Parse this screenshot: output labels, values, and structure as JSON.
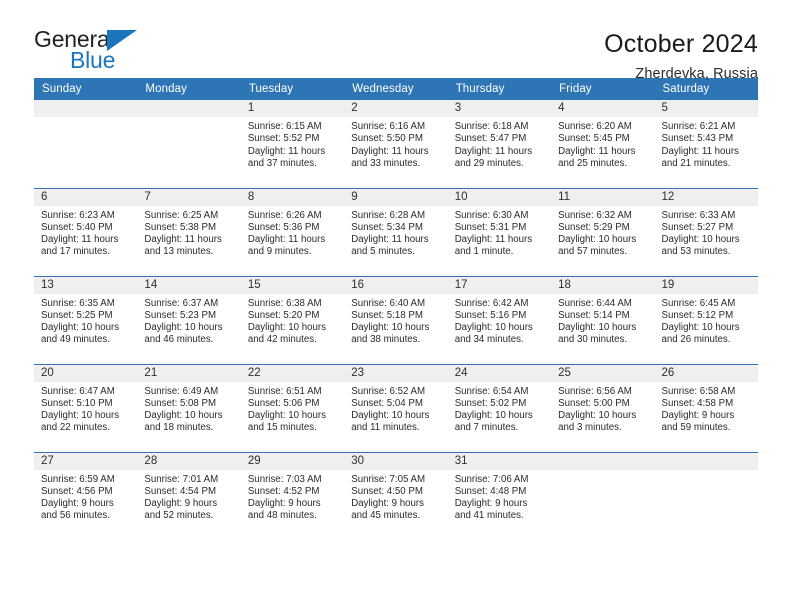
{
  "brand": {
    "name_top": "General",
    "name_bottom": "Blue",
    "accent_color": "#1b75bc"
  },
  "header": {
    "title": "October 2024",
    "subtitle": "Zherdevka, Russia"
  },
  "theme": {
    "header_blue": "#2e75b6",
    "date_band_gray": "#efefef",
    "text_color": "#2b2b2b"
  },
  "weekdays": [
    "Sunday",
    "Monday",
    "Tuesday",
    "Wednesday",
    "Thursday",
    "Friday",
    "Saturday"
  ],
  "weeks": [
    [
      {
        "day": "",
        "sunrise": "",
        "sunset": "",
        "daylight_1": "",
        "daylight_2": "",
        "empty": true
      },
      {
        "day": "",
        "sunrise": "",
        "sunset": "",
        "daylight_1": "",
        "daylight_2": "",
        "empty": true
      },
      {
        "day": "1",
        "sunrise": "Sunrise: 6:15 AM",
        "sunset": "Sunset: 5:52 PM",
        "daylight_1": "Daylight: 11 hours",
        "daylight_2": "and 37 minutes."
      },
      {
        "day": "2",
        "sunrise": "Sunrise: 6:16 AM",
        "sunset": "Sunset: 5:50 PM",
        "daylight_1": "Daylight: 11 hours",
        "daylight_2": "and 33 minutes."
      },
      {
        "day": "3",
        "sunrise": "Sunrise: 6:18 AM",
        "sunset": "Sunset: 5:47 PM",
        "daylight_1": "Daylight: 11 hours",
        "daylight_2": "and 29 minutes."
      },
      {
        "day": "4",
        "sunrise": "Sunrise: 6:20 AM",
        "sunset": "Sunset: 5:45 PM",
        "daylight_1": "Daylight: 11 hours",
        "daylight_2": "and 25 minutes."
      },
      {
        "day": "5",
        "sunrise": "Sunrise: 6:21 AM",
        "sunset": "Sunset: 5:43 PM",
        "daylight_1": "Daylight: 11 hours",
        "daylight_2": "and 21 minutes."
      }
    ],
    [
      {
        "day": "6",
        "sunrise": "Sunrise: 6:23 AM",
        "sunset": "Sunset: 5:40 PM",
        "daylight_1": "Daylight: 11 hours",
        "daylight_2": "and 17 minutes."
      },
      {
        "day": "7",
        "sunrise": "Sunrise: 6:25 AM",
        "sunset": "Sunset: 5:38 PM",
        "daylight_1": "Daylight: 11 hours",
        "daylight_2": "and 13 minutes."
      },
      {
        "day": "8",
        "sunrise": "Sunrise: 6:26 AM",
        "sunset": "Sunset: 5:36 PM",
        "daylight_1": "Daylight: 11 hours",
        "daylight_2": "and 9 minutes."
      },
      {
        "day": "9",
        "sunrise": "Sunrise: 6:28 AM",
        "sunset": "Sunset: 5:34 PM",
        "daylight_1": "Daylight: 11 hours",
        "daylight_2": "and 5 minutes."
      },
      {
        "day": "10",
        "sunrise": "Sunrise: 6:30 AM",
        "sunset": "Sunset: 5:31 PM",
        "daylight_1": "Daylight: 11 hours",
        "daylight_2": "and 1 minute."
      },
      {
        "day": "11",
        "sunrise": "Sunrise: 6:32 AM",
        "sunset": "Sunset: 5:29 PM",
        "daylight_1": "Daylight: 10 hours",
        "daylight_2": "and 57 minutes."
      },
      {
        "day": "12",
        "sunrise": "Sunrise: 6:33 AM",
        "sunset": "Sunset: 5:27 PM",
        "daylight_1": "Daylight: 10 hours",
        "daylight_2": "and 53 minutes."
      }
    ],
    [
      {
        "day": "13",
        "sunrise": "Sunrise: 6:35 AM",
        "sunset": "Sunset: 5:25 PM",
        "daylight_1": "Daylight: 10 hours",
        "daylight_2": "and 49 minutes."
      },
      {
        "day": "14",
        "sunrise": "Sunrise: 6:37 AM",
        "sunset": "Sunset: 5:23 PM",
        "daylight_1": "Daylight: 10 hours",
        "daylight_2": "and 46 minutes."
      },
      {
        "day": "15",
        "sunrise": "Sunrise: 6:38 AM",
        "sunset": "Sunset: 5:20 PM",
        "daylight_1": "Daylight: 10 hours",
        "daylight_2": "and 42 minutes."
      },
      {
        "day": "16",
        "sunrise": "Sunrise: 6:40 AM",
        "sunset": "Sunset: 5:18 PM",
        "daylight_1": "Daylight: 10 hours",
        "daylight_2": "and 38 minutes."
      },
      {
        "day": "17",
        "sunrise": "Sunrise: 6:42 AM",
        "sunset": "Sunset: 5:16 PM",
        "daylight_1": "Daylight: 10 hours",
        "daylight_2": "and 34 minutes."
      },
      {
        "day": "18",
        "sunrise": "Sunrise: 6:44 AM",
        "sunset": "Sunset: 5:14 PM",
        "daylight_1": "Daylight: 10 hours",
        "daylight_2": "and 30 minutes."
      },
      {
        "day": "19",
        "sunrise": "Sunrise: 6:45 AM",
        "sunset": "Sunset: 5:12 PM",
        "daylight_1": "Daylight: 10 hours",
        "daylight_2": "and 26 minutes."
      }
    ],
    [
      {
        "day": "20",
        "sunrise": "Sunrise: 6:47 AM",
        "sunset": "Sunset: 5:10 PM",
        "daylight_1": "Daylight: 10 hours",
        "daylight_2": "and 22 minutes."
      },
      {
        "day": "21",
        "sunrise": "Sunrise: 6:49 AM",
        "sunset": "Sunset: 5:08 PM",
        "daylight_1": "Daylight: 10 hours",
        "daylight_2": "and 18 minutes."
      },
      {
        "day": "22",
        "sunrise": "Sunrise: 6:51 AM",
        "sunset": "Sunset: 5:06 PM",
        "daylight_1": "Daylight: 10 hours",
        "daylight_2": "and 15 minutes."
      },
      {
        "day": "23",
        "sunrise": "Sunrise: 6:52 AM",
        "sunset": "Sunset: 5:04 PM",
        "daylight_1": "Daylight: 10 hours",
        "daylight_2": "and 11 minutes."
      },
      {
        "day": "24",
        "sunrise": "Sunrise: 6:54 AM",
        "sunset": "Sunset: 5:02 PM",
        "daylight_1": "Daylight: 10 hours",
        "daylight_2": "and 7 minutes."
      },
      {
        "day": "25",
        "sunrise": "Sunrise: 6:56 AM",
        "sunset": "Sunset: 5:00 PM",
        "daylight_1": "Daylight: 10 hours",
        "daylight_2": "and 3 minutes."
      },
      {
        "day": "26",
        "sunrise": "Sunrise: 6:58 AM",
        "sunset": "Sunset: 4:58 PM",
        "daylight_1": "Daylight: 9 hours",
        "daylight_2": "and 59 minutes."
      }
    ],
    [
      {
        "day": "27",
        "sunrise": "Sunrise: 6:59 AM",
        "sunset": "Sunset: 4:56 PM",
        "daylight_1": "Daylight: 9 hours",
        "daylight_2": "and 56 minutes."
      },
      {
        "day": "28",
        "sunrise": "Sunrise: 7:01 AM",
        "sunset": "Sunset: 4:54 PM",
        "daylight_1": "Daylight: 9 hours",
        "daylight_2": "and 52 minutes."
      },
      {
        "day": "29",
        "sunrise": "Sunrise: 7:03 AM",
        "sunset": "Sunset: 4:52 PM",
        "daylight_1": "Daylight: 9 hours",
        "daylight_2": "and 48 minutes."
      },
      {
        "day": "30",
        "sunrise": "Sunrise: 7:05 AM",
        "sunset": "Sunset: 4:50 PM",
        "daylight_1": "Daylight: 9 hours",
        "daylight_2": "and 45 minutes."
      },
      {
        "day": "31",
        "sunrise": "Sunrise: 7:06 AM",
        "sunset": "Sunset: 4:48 PM",
        "daylight_1": "Daylight: 9 hours",
        "daylight_2": "and 41 minutes."
      },
      {
        "day": "",
        "sunrise": "",
        "sunset": "",
        "daylight_1": "",
        "daylight_2": "",
        "empty": true
      },
      {
        "day": "",
        "sunrise": "",
        "sunset": "",
        "daylight_1": "",
        "daylight_2": "",
        "empty": true
      }
    ]
  ]
}
